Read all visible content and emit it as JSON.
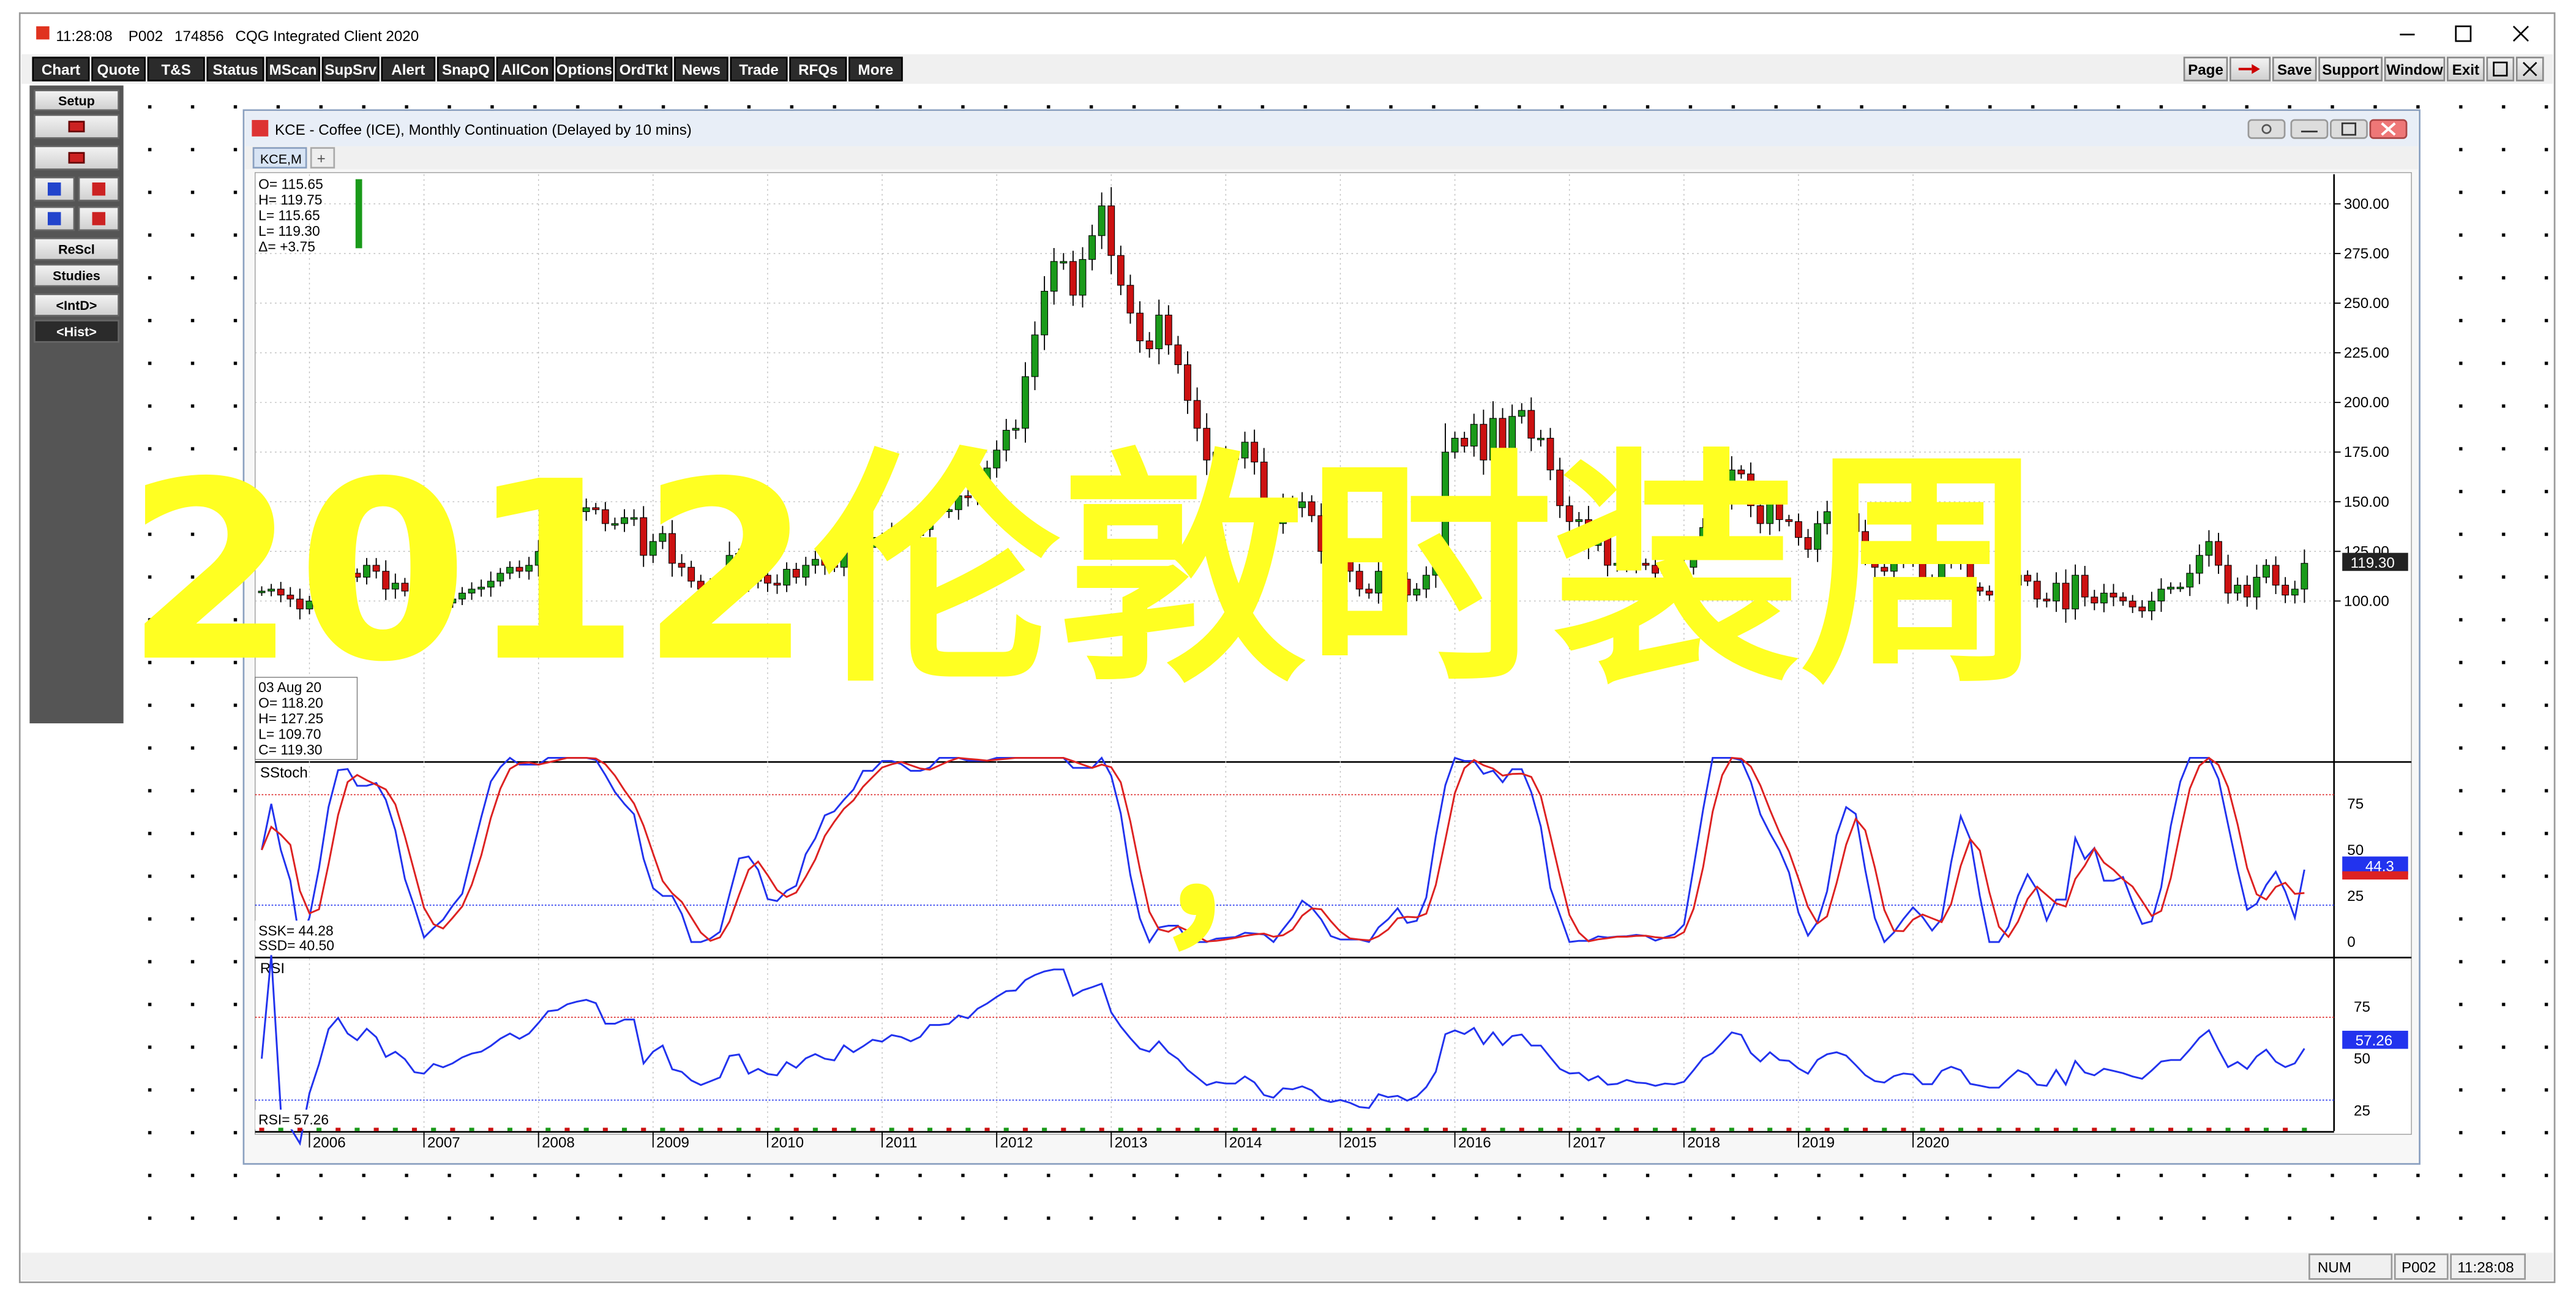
{
  "window": {
    "clock": "11:28:08",
    "page": "P002",
    "account": "174856",
    "app_title": "CQG Integrated Client 2020"
  },
  "toolbar": {
    "left": [
      "Chart",
      "Quote",
      "T&S",
      "Status",
      "MScan",
      "SupSrv",
      "Alert",
      "SnapQ",
      "AllCon",
      "Options",
      "OrdTkt",
      "News",
      "Trade",
      "RFQs",
      "More"
    ],
    "right": [
      "Page",
      "Save",
      "Support",
      "Window",
      "Exit"
    ]
  },
  "side_panel": {
    "buttons": [
      "Setup",
      "ReScl",
      "Studies",
      "<IntD>",
      "<Hist>"
    ]
  },
  "chart_window": {
    "title": "KCE - Coffee (ICE), Monthly Continuation (Delayed by 10 mins)",
    "tab": "KCE,M",
    "add_tab": "+"
  },
  "ohlc_header": [
    "O= 115.65",
    "H= 119.75",
    "L= 115.65",
    "L= 119.30",
    "Δ= +3.75"
  ],
  "ohlc_box": [
    "03 Aug 20",
    "O= 118.20",
    "H= 127.25",
    "L= 109.70",
    "C= 119.30"
  ],
  "price_axis": [
    "300.00",
    "275.00",
    "250.00",
    "225.00",
    "200.00",
    "175.00",
    "150.00",
    "125.00",
    "100.00"
  ],
  "last_price": "119.30",
  "stoch": {
    "label": "SStoch",
    "axis": [
      "75",
      "50",
      "25",
      "0"
    ],
    "values": [
      "SSK= 44.28",
      "SSD= 40.50"
    ],
    "last": "44.3"
  },
  "rsi": {
    "label": "RSI",
    "axis": [
      "75",
      "50",
      "25"
    ],
    "value": "RSI= 57.26",
    "last": "57.26"
  },
  "years": [
    "2006",
    "2007",
    "2008",
    "2009",
    "2010",
    "2011",
    "2012",
    "2013",
    "2014",
    "2015",
    "2016",
    "2017",
    "2018",
    "2019",
    "2020"
  ],
  "overlay_text": "2012伦敦时装周",
  "overlay_comma": "，",
  "status_bar": [
    "NUM",
    "P002",
    "11:28:08"
  ],
  "colors": {
    "up": "#1a9a1a",
    "down": "#cc1111",
    "blue": "#2233ee",
    "red_line": "#dd2222",
    "overlay": "#ffff22",
    "panel_gray": "#555555"
  },
  "chart_data": {
    "type": "candlestick",
    "x_start": "2005-08",
    "frequency": "monthly",
    "ylim": [
      85,
      310
    ],
    "close": [
      105,
      106,
      103,
      101,
      96,
      100,
      104,
      113,
      118,
      114,
      112,
      118,
      115,
      106,
      109,
      105,
      97,
      96,
      101,
      99,
      101,
      104,
      106,
      107,
      110,
      114,
      117,
      115,
      118,
      125,
      135,
      136,
      142,
      145,
      147,
      146,
      139,
      139,
      142,
      142,
      123,
      130,
      134,
      119,
      117,
      110,
      106,
      108,
      110,
      123,
      124,
      110,
      113,
      109,
      108,
      116,
      112,
      118,
      121,
      118,
      117,
      127,
      123,
      127,
      132,
      131,
      136,
      135,
      133,
      136,
      145,
      145,
      146,
      153,
      152,
      161,
      167,
      176,
      186,
      187,
      213,
      234,
      256,
      271,
      271,
      254,
      272,
      284,
      299,
      274,
      259,
      245,
      231,
      227,
      244,
      229,
      219,
      201,
      187,
      171,
      175,
      172,
      172,
      180,
      170,
      145,
      139,
      149,
      147,
      150,
      143,
      125,
      119,
      121,
      115,
      106,
      104,
      115,
      110,
      111,
      103,
      106,
      113,
      126,
      175,
      182,
      178,
      189,
      171,
      192,
      176,
      193,
      196,
      182,
      182,
      166,
      148,
      140,
      141,
      128,
      133,
      118,
      119,
      123,
      119,
      118,
      114,
      116,
      115,
      117,
      126,
      137,
      142,
      153,
      166,
      164,
      148,
      139,
      149,
      141,
      140,
      132,
      126,
      139,
      145,
      147,
      144,
      135,
      124,
      117,
      115,
      120,
      122,
      121,
      111,
      111,
      120,
      123,
      120,
      107,
      105,
      103,
      103,
      108,
      113,
      110,
      101,
      100,
      109,
      96,
      113,
      102,
      99,
      104,
      102,
      100,
      97,
      95,
      100,
      106,
      107,
      107,
      114,
      123,
      130,
      118,
      104,
      108,
      102,
      112,
      118,
      108,
      103,
      106,
      119
    ]
  }
}
